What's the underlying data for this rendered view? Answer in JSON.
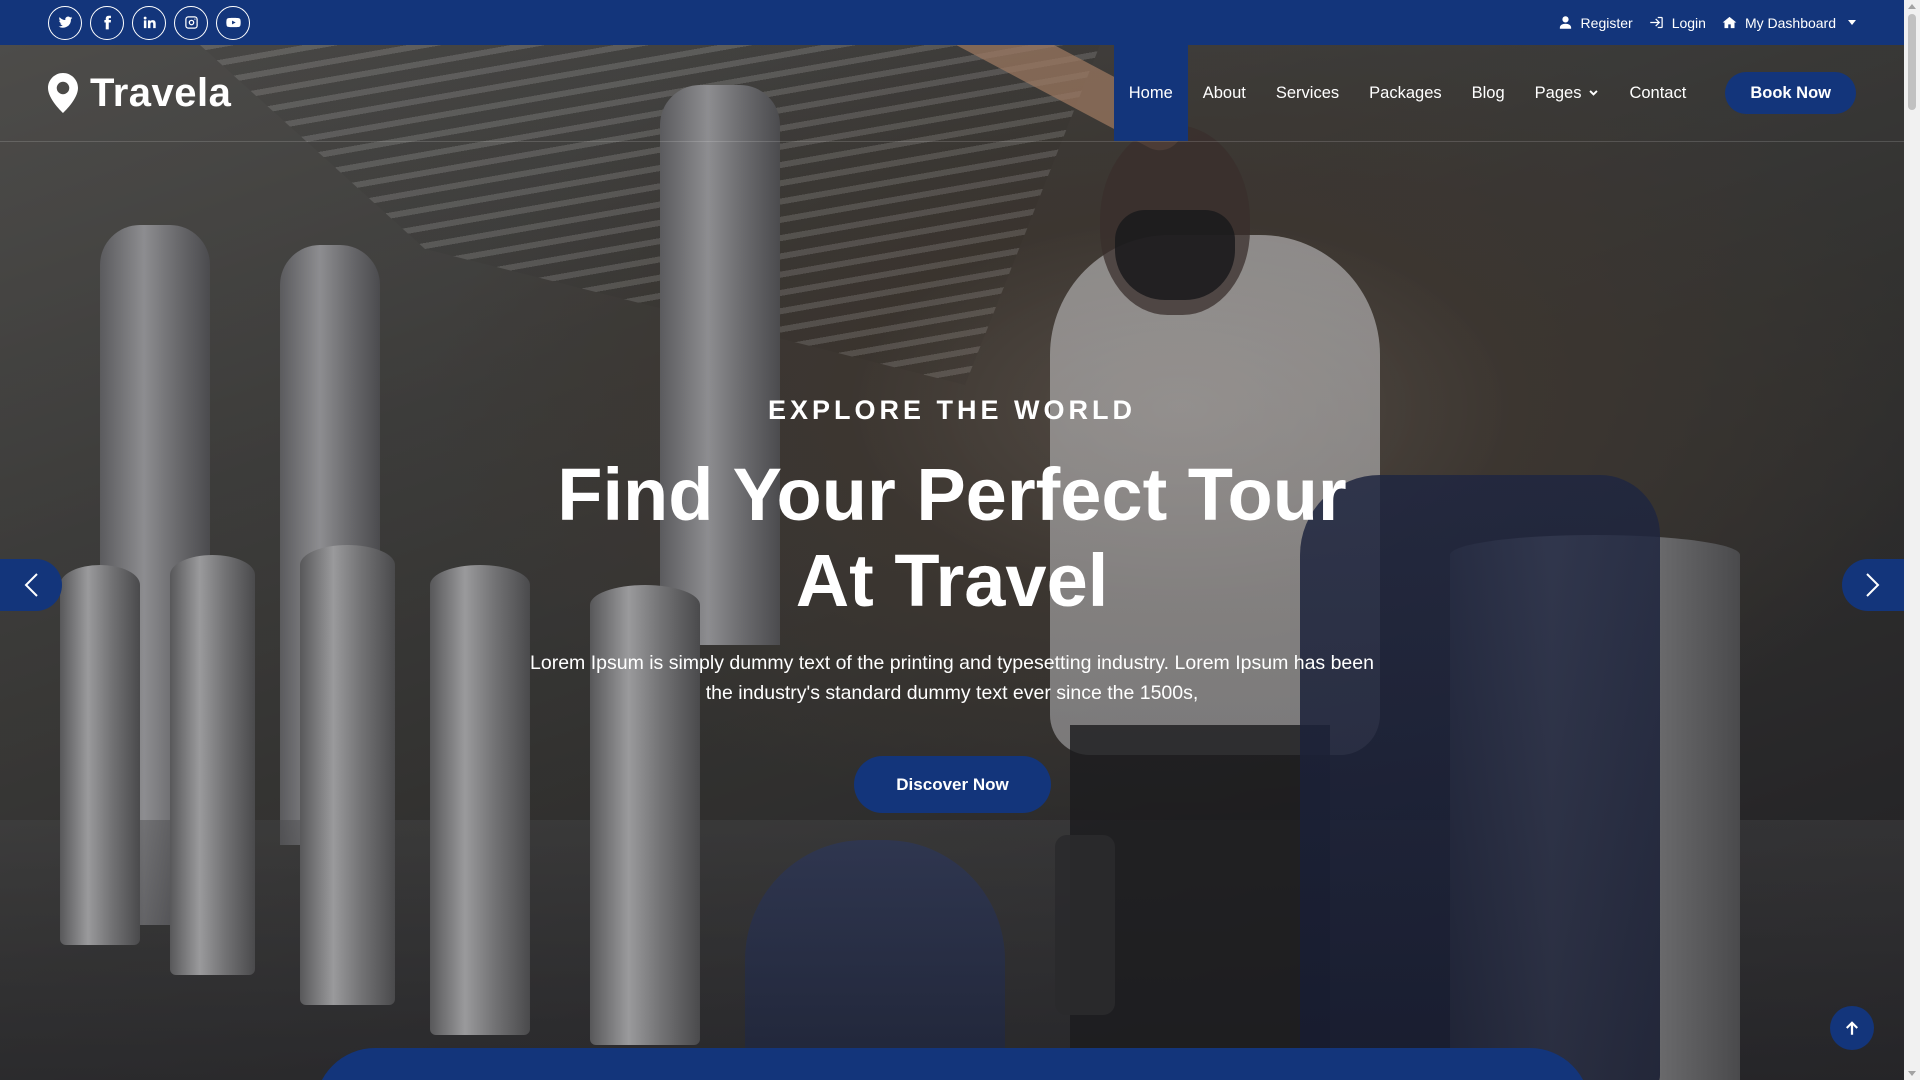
{
  "topbar": {
    "socials": [
      {
        "icon": "twitter-icon"
      },
      {
        "icon": "facebook-icon"
      },
      {
        "icon": "linkedin-icon"
      },
      {
        "icon": "instagram-icon"
      },
      {
        "icon": "youtube-icon"
      }
    ],
    "register_label": "Register",
    "login_label": "Login",
    "dashboard_label": "My Dashboard"
  },
  "navbar": {
    "brand": "Travela",
    "items": [
      {
        "label": "Home",
        "active": true
      },
      {
        "label": "About"
      },
      {
        "label": "Services"
      },
      {
        "label": "Packages"
      },
      {
        "label": "Blog"
      },
      {
        "label": "Pages",
        "dropdown": true
      },
      {
        "label": "Contact"
      }
    ],
    "book_label": "Book Now"
  },
  "hero": {
    "eyebrow": "EXPLORE THE WORLD",
    "headline": "Find Your Perfect Tour At Travel",
    "lede": "Lorem Ipsum is simply dummy text of the printing and typesetting industry. Lorem Ipsum has been the industry's standard dummy text ever since the 1500s,",
    "cta_label": "Discover Now"
  },
  "colors": {
    "primary": "#13357b",
    "text_on_dark": "#ffffff"
  }
}
